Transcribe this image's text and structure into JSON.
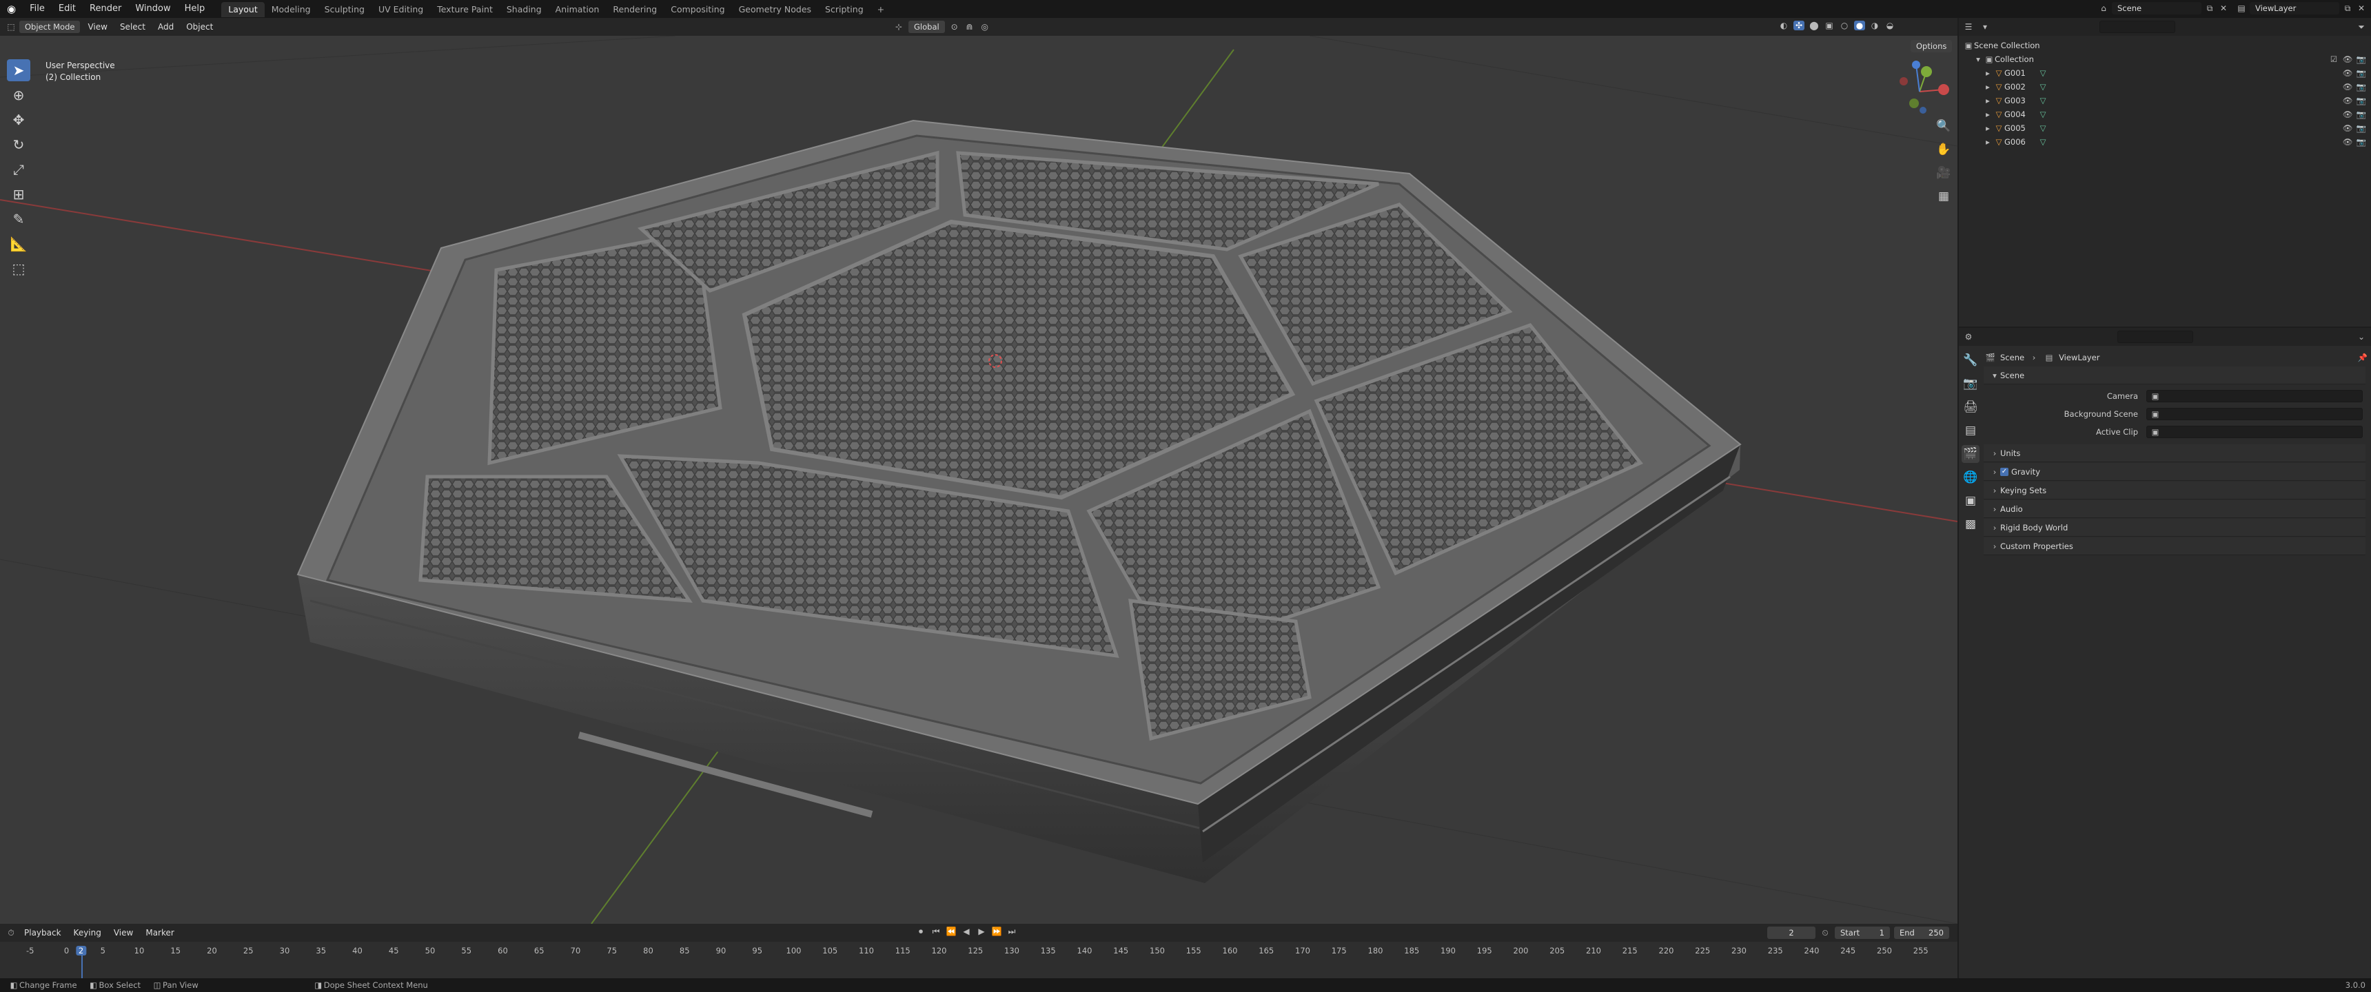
{
  "topbar": {
    "menus": [
      "File",
      "Edit",
      "Render",
      "Window",
      "Help"
    ],
    "workspaces": [
      "Layout",
      "Modeling",
      "Sculpting",
      "UV Editing",
      "Texture Paint",
      "Shading",
      "Animation",
      "Rendering",
      "Compositing",
      "Geometry Nodes",
      "Scripting"
    ],
    "active_workspace": "Layout",
    "add_workspace": "+",
    "scene": "Scene",
    "view_layer": "ViewLayer"
  },
  "viewport_header": {
    "mode": "Object Mode",
    "menus": [
      "View",
      "Select",
      "Add",
      "Object"
    ],
    "orientation": "Global",
    "options": "Options"
  },
  "viewport": {
    "view_name": "User Perspective",
    "collection_info": "(2) Collection"
  },
  "outliner": {
    "root": "Scene Collection",
    "collection": "Collection",
    "objects": [
      "G001",
      "G002",
      "G003",
      "G004",
      "G005",
      "G006"
    ]
  },
  "properties": {
    "breadcrumb": [
      "Scene",
      "ViewLayer"
    ],
    "panel_title": "Scene",
    "fields": [
      {
        "label": "Camera",
        "value": ""
      },
      {
        "label": "Background Scene",
        "value": ""
      },
      {
        "label": "Active Clip",
        "value": ""
      }
    ],
    "sections": [
      {
        "label": "Units",
        "checkbox": false
      },
      {
        "label": "Gravity",
        "checkbox": true
      },
      {
        "label": "Keying Sets",
        "checkbox": false
      },
      {
        "label": "Audio",
        "checkbox": false
      },
      {
        "label": "Rigid Body World",
        "checkbox": false
      },
      {
        "label": "Custom Properties",
        "checkbox": false
      }
    ]
  },
  "timeline": {
    "menus": [
      "Playback",
      "Keying",
      "View",
      "Marker"
    ],
    "current_frame": "2",
    "start_label": "Start",
    "start": "1",
    "end_label": "End",
    "end": "250",
    "ticks": [
      "-5",
      "0",
      "2",
      "5",
      "10",
      "15",
      "20",
      "25",
      "30",
      "35",
      "40",
      "45",
      "50",
      "55",
      "60",
      "65",
      "70",
      "75",
      "80",
      "85",
      "90",
      "95",
      "100",
      "105",
      "110",
      "115",
      "120",
      "125",
      "130",
      "135",
      "140",
      "145",
      "150",
      "155",
      "160",
      "165",
      "170",
      "175",
      "180",
      "185",
      "190",
      "195",
      "200",
      "205",
      "210",
      "215",
      "220",
      "225",
      "230",
      "235",
      "240",
      "245",
      "250",
      "255"
    ]
  },
  "statusbar": {
    "items": [
      "Change Frame",
      "Box Select",
      "Pan View",
      "Dope Sheet Context Menu"
    ],
    "version": "3.0.0"
  },
  "colors": {
    "accent": "#4772b3",
    "x_axis": "#c94a4a",
    "y_axis": "#7eab3a",
    "frame_marker": "#4772b3"
  }
}
